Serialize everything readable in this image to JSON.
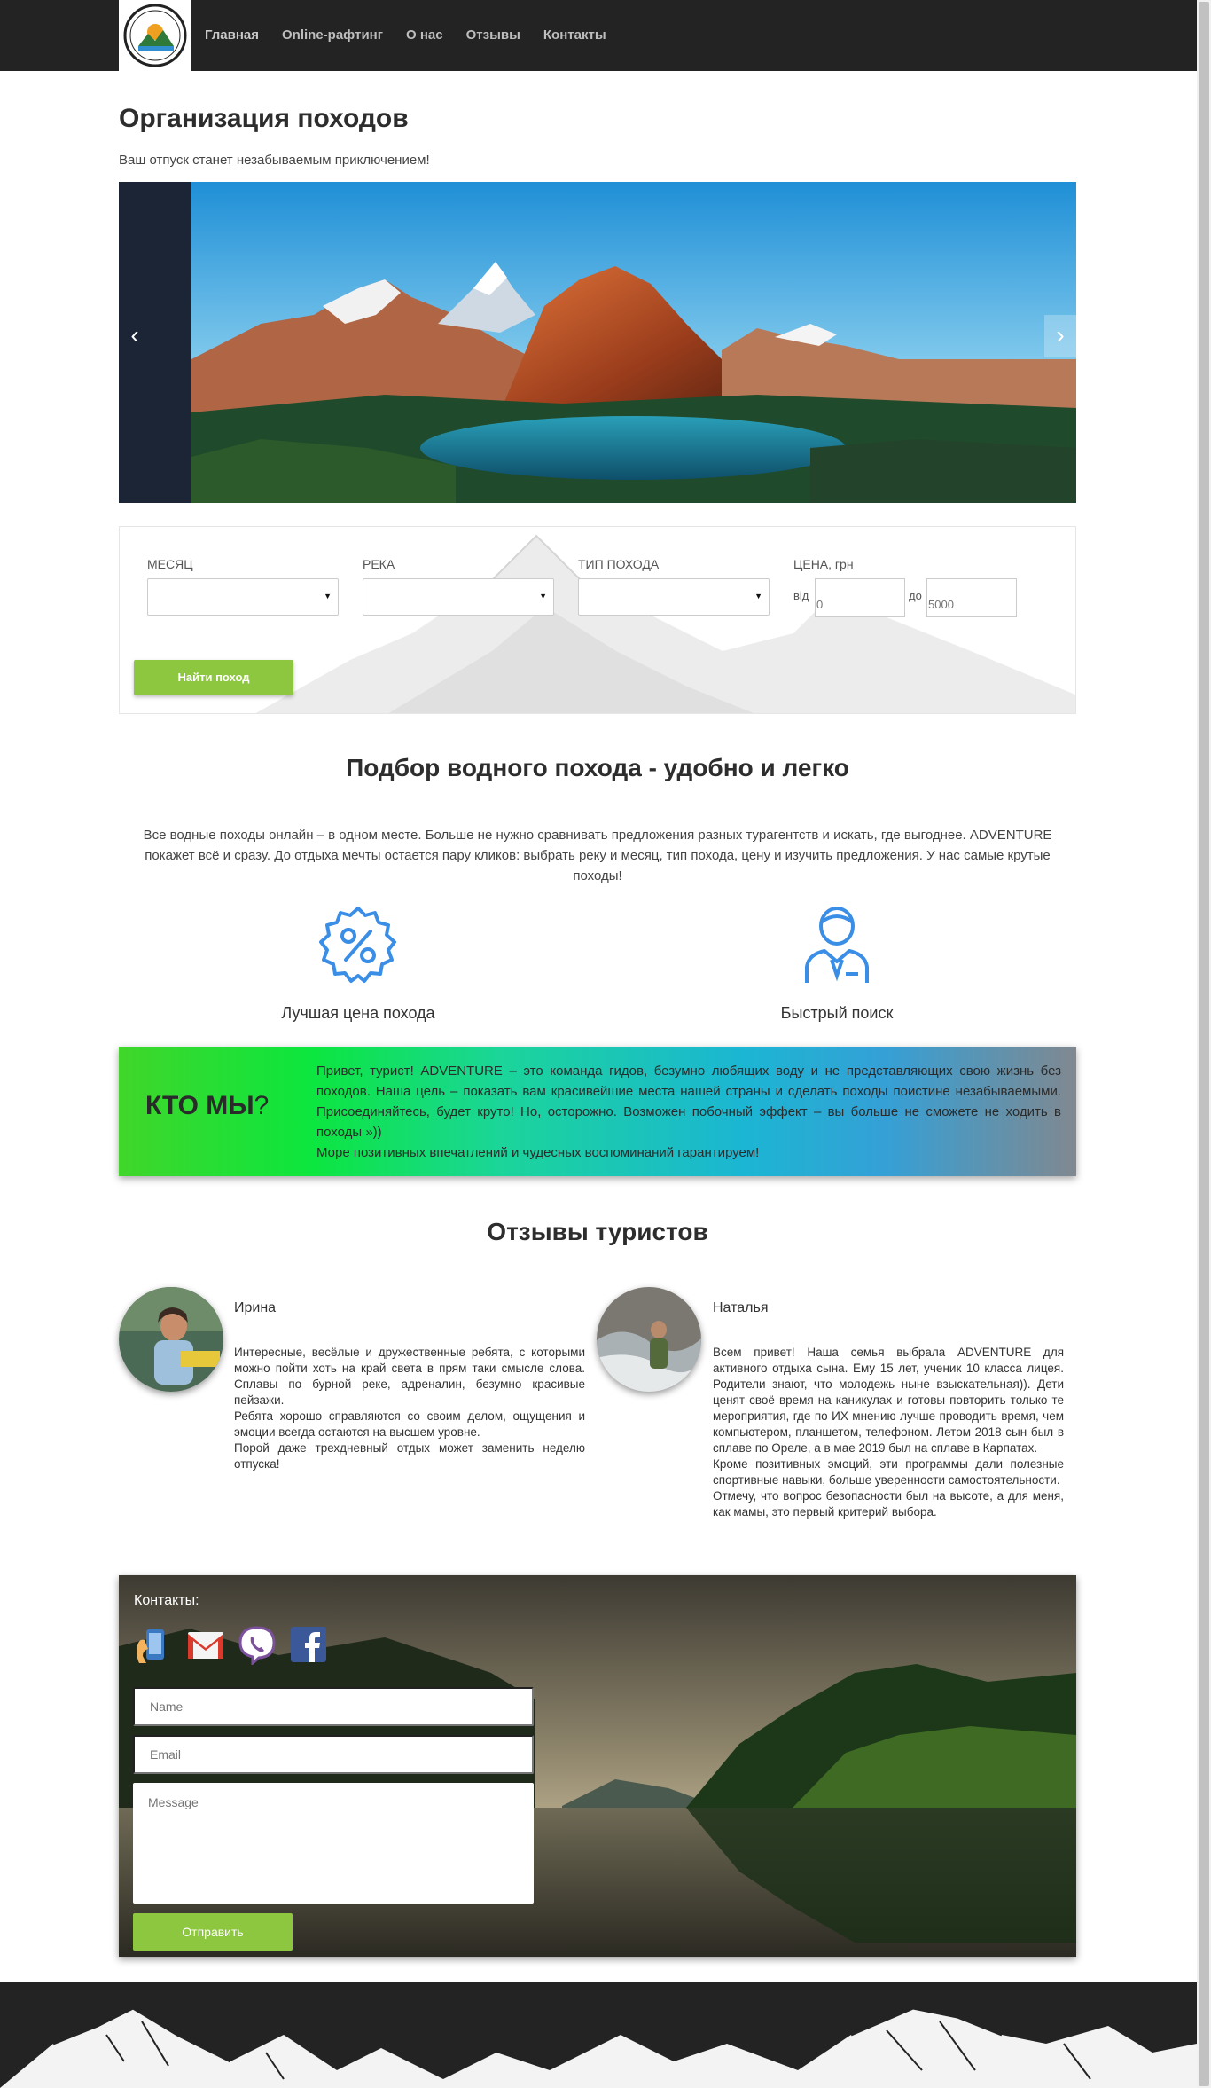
{
  "nav": {
    "logo_text": "ADVENTURE",
    "logo_subtext": "WILD LIFE BEGINS",
    "items": [
      {
        "label": "Главная"
      },
      {
        "label": "Online-рафтинг"
      },
      {
        "label": "О нас"
      },
      {
        "label": "Отзывы"
      },
      {
        "label": "Контакты"
      }
    ]
  },
  "header": {
    "title": "Организация походов",
    "subtitle": "Ваш отпуск станет незабываемым приключением!"
  },
  "carousel": {
    "prev_icon": "chevron-left-icon",
    "next_icon": "chevron-right-icon"
  },
  "search": {
    "month_label": "МЕСЯЦ",
    "river_label": "РЕКА",
    "type_label": "ТИП ПОХОДА",
    "price_label": "ЦЕНА, грн",
    "from_word": "від",
    "to_word": "до",
    "from_placeholder": "0",
    "to_placeholder": "5000",
    "button": "Найти поход"
  },
  "about": {
    "title": "Подбор водного похода - удобно и легко",
    "text": "Все водные походы онлайн – в одном месте. Больше не нужно сравнивать предложения разных турагентств и искать, где выгоднее. ADVENTURE покажет всё и сразу. До отдыха мечты остается пару кликов: выбрать реку и месяц, тип похода, цену и изучить предложения. У нас самые крутые походы!",
    "features": [
      {
        "label": "Лучшая цена похода",
        "icon": "discount-badge-icon"
      },
      {
        "label": "Быстрый поиск",
        "icon": "user-search-icon"
      }
    ]
  },
  "who": {
    "title": "КТО МЫ",
    "title_mark": "?",
    "text_1": "Привет, турист! ADVENTURE – это команда гидов, безумно любящих воду и не представляющих свою жизнь без походов. Наша цель – показать вам красивейшие места нашей страны и сделать походы поистине незабываемыми. Присоединяйтесь, будет круто! Но, осторожно. Возможен побочный эффект – вы больше не сможете не ходить в походы »))",
    "text_2": "Море позитивных впечатлений и чудесных воспоминаний гарантируем!"
  },
  "reviews": {
    "title": "Отзывы туристов",
    "items": [
      {
        "name": "Ирина",
        "paragraphs": [
          "Интересные, весёлые и дружественные ребята, с которыми можно пойти хоть на край света в прям таки смысле слова. Сплавы по бурной реке, адреналин, безумно красивые пейзажи.",
          "Ребята хорошо справляются со своим делом, ощущения и эмоции всегда остаются на высшем уровне.",
          "Порой даже трехдневный отдых может заменить неделю отпуска!"
        ]
      },
      {
        "name": "Наталья",
        "paragraphs": [
          "Всем привет! Наша семья выбрала ADVENTURE для активного отдыха сына. Ему 15 лет, ученик 10 класса лицея. Родители знают, что молодежь ныне взыскательная)). Дети ценят своё время на каникулах и готовы повторить только те мероприятия, где по ИХ мнению лучше проводить время, чем компьютером, планшетом, телефоном. Летом 2018 сын был в сплаве по Ореле, а в мае 2019 был на сплаве в Карпатах.",
          "Кроме позитивных эмоций, эти программы дали полезные спортивные навыки, больше уверенности самостоятельности.",
          "Отмечу, что вопрос безопасности был на высоте, а для меня, как мамы, это первый критерий выбора."
        ]
      }
    ]
  },
  "contacts": {
    "title": "Контакты:",
    "social": [
      "phone-icon",
      "gmail-icon",
      "viber-icon",
      "facebook-icon"
    ],
    "name_placeholder": "Name",
    "email_placeholder": "Email",
    "message_placeholder": "Message",
    "send": "Отправить"
  },
  "colors": {
    "nav_bg": "#232323",
    "accent_green": "#8dc63f",
    "icon_blue": "#3a8ee6"
  }
}
